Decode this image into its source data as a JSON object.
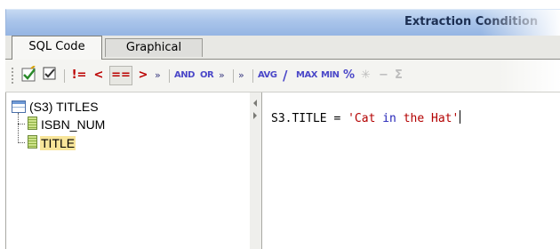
{
  "window": {
    "title": "Extraction Condition"
  },
  "tabs": [
    {
      "label": "SQL Code",
      "active": true
    },
    {
      "label": "Graphical",
      "active": false
    }
  ],
  "toolbar": {
    "ops": [
      "!=",
      "<",
      "==",
      ">",
      "»"
    ],
    "logic": [
      "AND",
      "OR",
      "»",
      "»"
    ],
    "funcs": [
      "AVG",
      "/",
      "MAX",
      "MIN",
      "%",
      "✳",
      "−",
      "Σ"
    ]
  },
  "tree": {
    "root": "(S3) TITLES",
    "columns": [
      "ISBN_NUM",
      "TITLE"
    ],
    "selected": "TITLE"
  },
  "editor": {
    "tokens": [
      {
        "text": "S3.TITLE = ",
        "type": "id"
      },
      {
        "text": "'Cat ",
        "type": "str"
      },
      {
        "text": "in",
        "type": "kw"
      },
      {
        "text": " the Hat'",
        "type": "str"
      }
    ]
  },
  "colors": {
    "accent": "#bb0000",
    "keyword": "#4b48c8",
    "selection": "#f8e59a"
  }
}
